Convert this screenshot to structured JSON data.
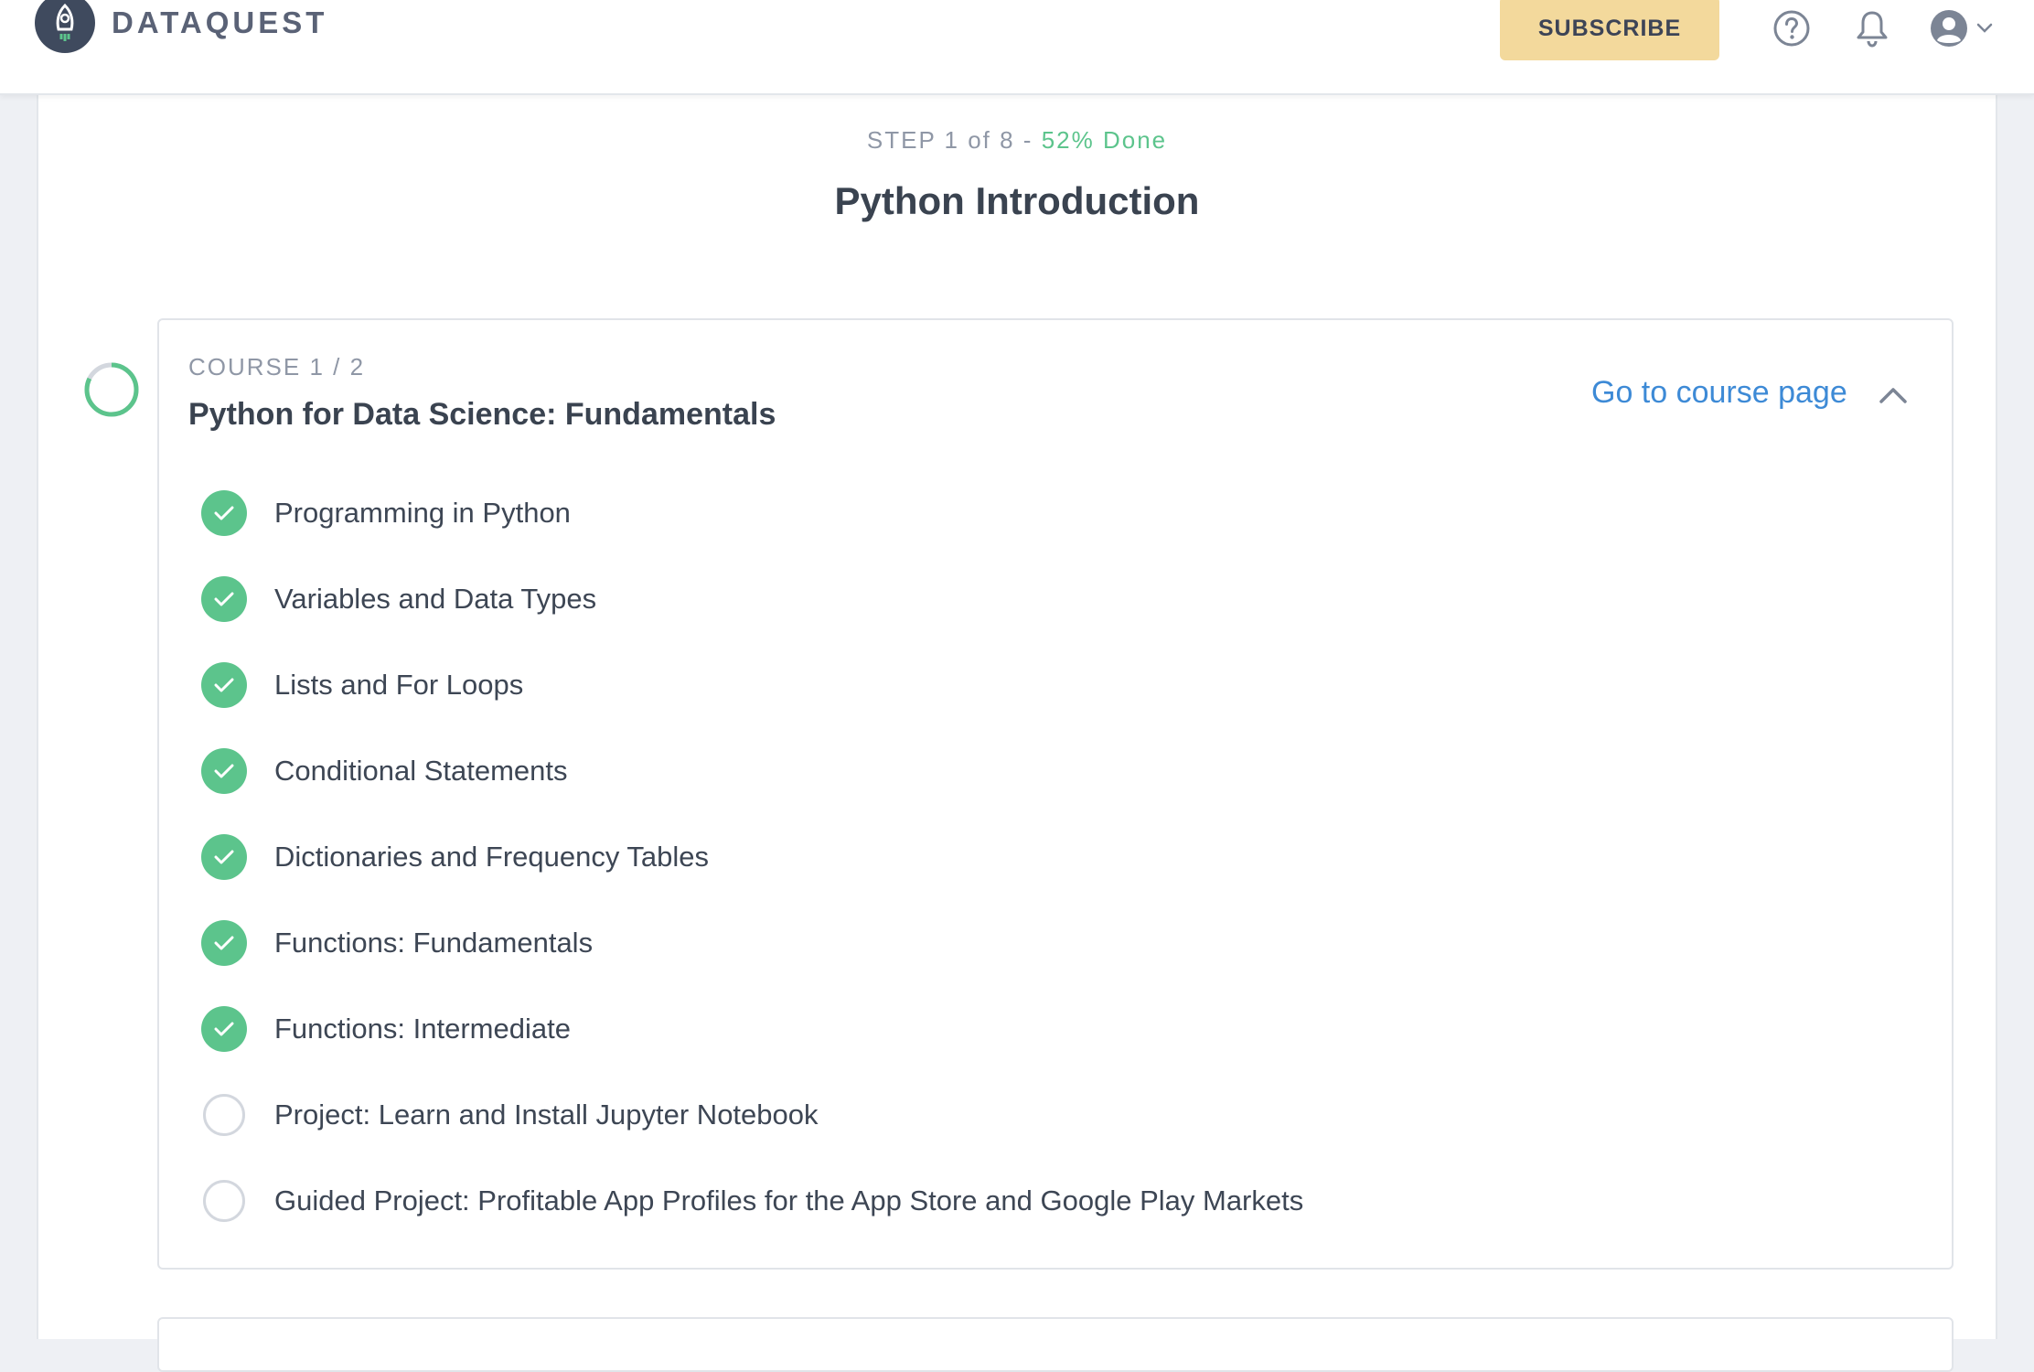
{
  "nav": {
    "brand": "DATAQUEST",
    "subscribe_label": "SUBSCRIBE",
    "icons": [
      "help-icon",
      "bell-icon",
      "user-avatar-icon",
      "chevron-down-icon"
    ]
  },
  "path": {
    "step_text": "STEP 1 of 8 - ",
    "done_text": "52% Done",
    "title": "Python Introduction"
  },
  "course": {
    "kicker": "COURSE 1 / 2",
    "title": "Python for Data Science: Fundamentals",
    "link_label": "Go to course page",
    "lessons": [
      {
        "label": "Programming in Python",
        "status": "completed"
      },
      {
        "label": "Variables and Data Types",
        "status": "completed"
      },
      {
        "label": "Lists and For Loops",
        "status": "completed"
      },
      {
        "label": "Conditional Statements",
        "status": "completed"
      },
      {
        "label": "Dictionaries and Frequency Tables",
        "status": "completed"
      },
      {
        "label": "Functions: Fundamentals",
        "status": "completed"
      },
      {
        "label": "Functions: Intermediate",
        "status": "completed"
      },
      {
        "label": "Project: Learn and Install Jupyter Notebook",
        "status": "incomplete"
      },
      {
        "label": "Guided Project: Profitable App Profiles for the App Store and Google Play Markets",
        "status": "incomplete"
      }
    ]
  },
  "colors": {
    "accent_green": "#5cc48c",
    "link_blue": "#3d8ad6",
    "subscribe_bg": "#f3d99c"
  }
}
